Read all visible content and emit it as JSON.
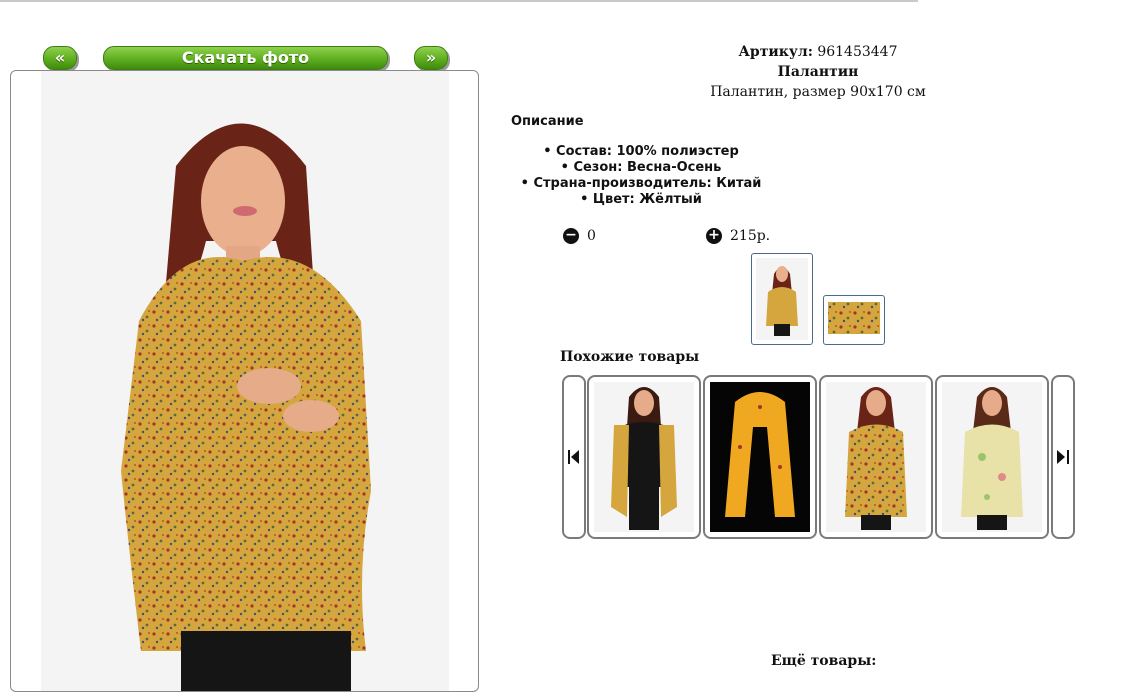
{
  "nav": {
    "prev_label": "«",
    "download_label": "Скачать фото",
    "next_label": "»"
  },
  "product": {
    "article_label": "Артикул:",
    "article_value": "961453447",
    "name": "Палантин",
    "subtitle": "Палантин, размер 90x170 см"
  },
  "description": {
    "title": "Описание",
    "items": [
      "Состав: 100% полиэстер",
      "Сезон: Весна-Осень",
      "Страна-производитель: Китай",
      "Цвет: Жёлтый"
    ]
  },
  "cart": {
    "quantity": "0",
    "price": "215р."
  },
  "similar": {
    "title": "Похожие товары"
  },
  "more": {
    "title": "Ещё товары:"
  },
  "colors": {
    "button_green": "#5fae1f",
    "scarf_yellow": "#d9a83a",
    "border_gray": "#7a7a7a"
  }
}
